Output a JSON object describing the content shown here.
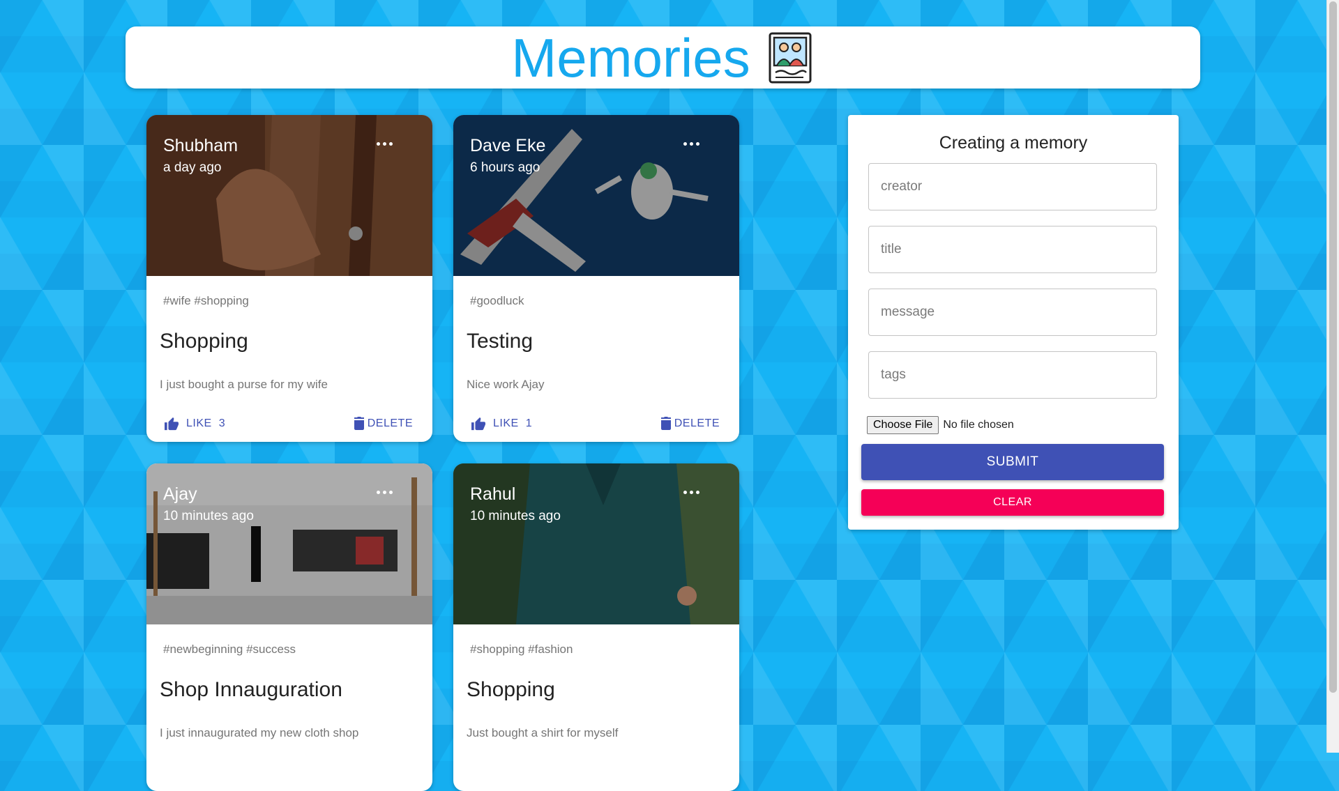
{
  "app": {
    "title": "Memories",
    "logo_icon": "memories-photo-icon"
  },
  "colors": {
    "accent": "#3f51b5",
    "secondary": "#f50057",
    "heading": "#16a8ee",
    "background": "#16b4f5"
  },
  "posts": [
    {
      "creator": "Shubham",
      "time": "a day ago",
      "tags": "#wife #shopping",
      "title": "Shopping",
      "message": "I just bought a purse for my wife",
      "like_label": "LIKE",
      "likes": "3",
      "delete_label": "DELETE",
      "image_theme": "brown-purse"
    },
    {
      "creator": "Dave Eke",
      "time": "6 hours ago",
      "tags": "#goodluck",
      "title": "Testing",
      "message": "Nice work Ajay",
      "like_label": "LIKE",
      "likes": "1",
      "delete_label": "DELETE",
      "image_theme": "skydive-plane"
    },
    {
      "creator": "Ajay",
      "time": "10 minutes ago",
      "tags": "#newbeginning #success",
      "title": "Shop Innauguration",
      "message": "I just innaugurated my new cloth shop",
      "image_theme": "clothing-store"
    },
    {
      "creator": "Rahul",
      "time": "10 minutes ago",
      "tags": "#shopping #fashion",
      "title": "Shopping",
      "message": "Just bought a shirt for myself",
      "image_theme": "green-shirt"
    }
  ],
  "form": {
    "title": "Creating a memory",
    "creator_placeholder": "creator",
    "title_placeholder": "title",
    "message_placeholder": "message",
    "tags_placeholder": "tags",
    "file_button": "Choose File",
    "file_status": "No file chosen",
    "submit_label": "SUBMIT",
    "clear_label": "CLEAR"
  }
}
